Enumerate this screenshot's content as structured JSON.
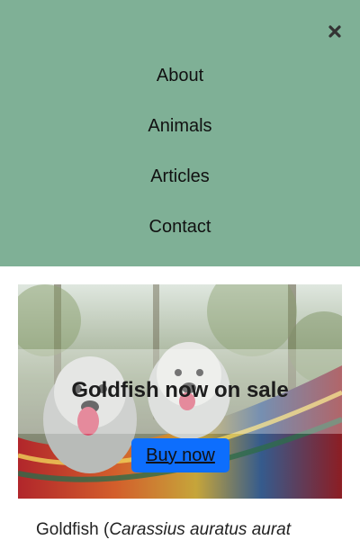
{
  "menu": {
    "background": "#7fb096",
    "close_icon": "close-icon",
    "items": [
      {
        "label": "About"
      },
      {
        "label": "Animals"
      },
      {
        "label": "Articles"
      },
      {
        "label": "Contact"
      }
    ]
  },
  "hero": {
    "image": "photo of two shaggy dogs in a striped hammock",
    "title": "Goldfish now on sale",
    "button_label": "Buy now",
    "button_color": "#0d6efd"
  },
  "caption": {
    "prefix": "Goldfish (",
    "italic": "Carassius auratus aurat"
  }
}
